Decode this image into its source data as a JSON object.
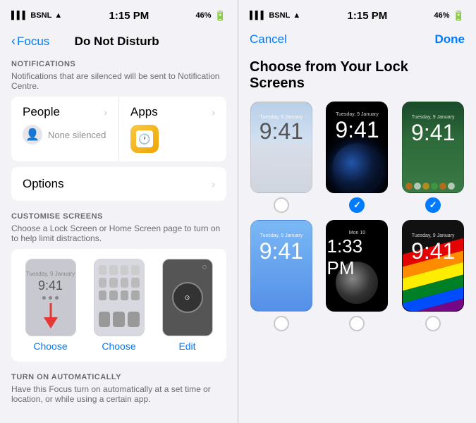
{
  "left": {
    "status": {
      "carrier": "BSNL",
      "time": "1:15 PM",
      "battery": "46%"
    },
    "back_label": "Focus",
    "page_title": "Do Not Disturb",
    "notifications_section": {
      "label": "NOTIFICATIONS",
      "description": "Notifications that are silenced will be sent to Notification Centre."
    },
    "people_cell": {
      "title": "People",
      "sub": "None silenced"
    },
    "apps_cell": {
      "title": "Apps"
    },
    "options_row": {
      "label": "Options"
    },
    "customise_section": {
      "label": "CUSTOMISE SCREENS",
      "description": "Choose a Lock Screen or Home Screen page to turn on to help limit distractions."
    },
    "screen_buttons": {
      "choose1": "Choose",
      "choose2": "Choose",
      "edit": "Edit"
    },
    "turn_on_section": {
      "label": "TURN ON AUTOMATICALLY",
      "description": "Have this Focus turn on automatically at a set time or location, or while using a certain app."
    }
  },
  "right": {
    "status": {
      "carrier": "BSNL",
      "time": "1:15 PM",
      "battery": "46%"
    },
    "cancel_label": "Cancel",
    "done_label": "Done",
    "title": "Choose from Your Lock Screens",
    "screens": [
      {
        "id": "clouds",
        "time": "9:41",
        "date": "Tuesday, 9 January",
        "selected": false
      },
      {
        "id": "earth",
        "time": "9:41",
        "date": "Tuesday, 9 January",
        "selected": true
      },
      {
        "id": "clownfish",
        "time": "9:41",
        "date": "Tuesday, 9 January",
        "selected": true
      },
      {
        "id": "blue",
        "time": "9:41",
        "date": "Tuesday, 9 January",
        "selected": false
      },
      {
        "id": "moon",
        "time": "1:33 PM",
        "date": "Mon 10",
        "selected": false
      },
      {
        "id": "rainbow",
        "time": "9:41",
        "date": "Tuesday, 9 January",
        "selected": false
      }
    ]
  }
}
